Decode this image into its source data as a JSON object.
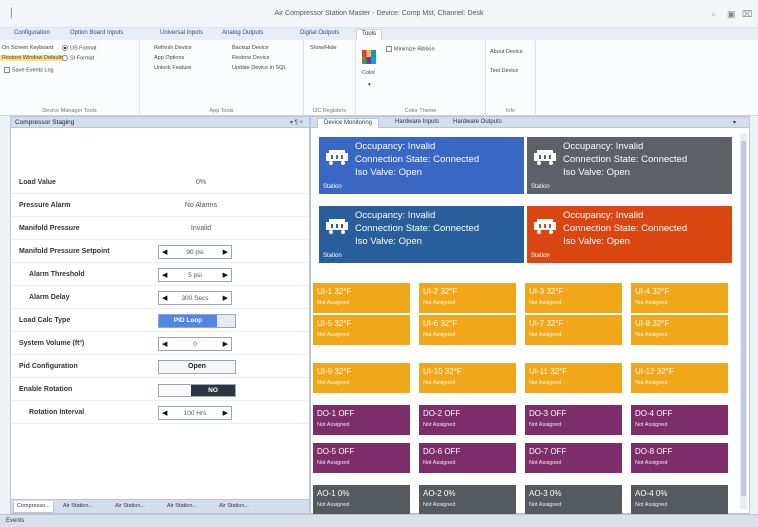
{
  "window": {
    "title": "Air Compressor Station Master - Device: Comp Mst, Channel: Desk"
  },
  "ribbon_tabs": [
    "Configuration",
    "Option Board Inputs",
    "Universal Inputs",
    "Analog Outputs",
    "Digital Outputs",
    "Tools"
  ],
  "ribbon": {
    "device_manager": {
      "title": "Device Manager Tools",
      "on_screen_keyboard": "On Screen Keyboard",
      "restore_window_defaults": "Restore Window Defaults",
      "save_events_log": "Save Events Log",
      "us_format": "US Format",
      "si_format": "SI Format"
    },
    "app_tools": {
      "title": "App Tools",
      "refresh_device": "Refresh Device",
      "app_options": "App Options",
      "unlock_feature": "Unlock Feature",
      "backup_device": "Backup Device",
      "restore_device": "Restore Device",
      "update_device": "Update Device in SQL"
    },
    "i2c": {
      "title": "I2C Registers",
      "show_hide": "Show/Hide"
    },
    "color_theme": {
      "title": "Color Theme",
      "color_label": "Color",
      "minimize_ribbon": "Minimize Ribbon"
    },
    "info": {
      "title": "Info",
      "about_device": "About Device",
      "test_device": "Test Device"
    }
  },
  "left_panel": {
    "title": "Compressor Staging",
    "header_buttons": "▾ ¶ ×",
    "rows": {
      "load_value": {
        "label": "Load Value",
        "value": "0%"
      },
      "pressure_alarm": {
        "label": "Pressure Alarm",
        "value": "No Alarms"
      },
      "manifold_pressure": {
        "label": "Manifold Pressure",
        "value": "Invalid"
      },
      "manifold_setpoint": {
        "label": "Manifold Pressure Setpoint",
        "value": "90 psi"
      },
      "alarm_threshold": {
        "label": "Alarm Threshold",
        "value": "5 psi"
      },
      "alarm_delay": {
        "label": "Alarm Delay",
        "value": "300 Secs"
      },
      "load_calc_type": {
        "label": "Load Calc Type",
        "value": "PID Loop"
      },
      "system_volume": {
        "label": "System Volume (ft³)",
        "value": "0"
      },
      "pid_config": {
        "label": "Pid Configuration",
        "value": "Open"
      },
      "enable_rotation": {
        "label": "Enable Rotation",
        "value": "NO"
      },
      "rotation_interval": {
        "label": "Rotation Interval",
        "value": "100 Hrs"
      }
    },
    "bottom_tabs": [
      "Compresso...",
      "Air Station...",
      "Air Station...",
      "Air Station...",
      "Air Station..."
    ]
  },
  "right_panel": {
    "tabs": [
      "Device Monitoring",
      "Hardware Inputs",
      "Hardware Outputs"
    ],
    "stations": [
      {
        "occupancy": "Occupancy: Invalid",
        "connection": "Connection State: Connected",
        "iso": "Iso Valve: Open",
        "label": "Station",
        "color": "#3a67c4"
      },
      {
        "occupancy": "Occupancy: Invalid",
        "connection": "Connection State: Connected",
        "iso": "Iso Valve: Open",
        "label": "Station",
        "color": "#5d6066"
      },
      {
        "occupancy": "Occupancy: Invalid",
        "connection": "Connection State: Connected",
        "iso": "Iso Valve: Open",
        "label": "Station",
        "color": "#285e9c"
      },
      {
        "occupancy": "Occupancy: Invalid",
        "connection": "Connection State: Connected",
        "iso": "Iso Valve: Open",
        "label": "Station",
        "color": "#d94612"
      }
    ],
    "ui_tiles": [
      {
        "h": "UI-1  32°F",
        "s": "Not Assigned"
      },
      {
        "h": "UI-2  32°F",
        "s": "Not Assigned"
      },
      {
        "h": "UI-3  32°F",
        "s": "Not Assigned"
      },
      {
        "h": "UI-4  32°F",
        "s": "Not Assigned"
      },
      {
        "h": "UI-5  32°F",
        "s": "Not Assigned"
      },
      {
        "h": "UI-6  32°F",
        "s": "Not Assigned"
      },
      {
        "h": "UI-7  32°F",
        "s": "Not Assigned"
      },
      {
        "h": "UI-8  32°F",
        "s": "Not Assigned"
      },
      {
        "h": "UI-9  32°F",
        "s": "Not Assigned"
      },
      {
        "h": "UI-10  32°F",
        "s": "Not Assigned"
      },
      {
        "h": "UI-11  32°F",
        "s": "Not Assigned"
      },
      {
        "h": "UI-12  32°F",
        "s": "Not Assigned"
      }
    ],
    "do_tiles": [
      {
        "h": "DO-1  OFF",
        "s": "Not Assigned"
      },
      {
        "h": "DO-2  OFF",
        "s": "Not Assigned"
      },
      {
        "h": "DO-3  OFF",
        "s": "Not Assigned"
      },
      {
        "h": "DO-4  OFF",
        "s": "Not Assigned"
      },
      {
        "h": "DO-5  OFF",
        "s": "Not Assigned"
      },
      {
        "h": "DO-6  OFF",
        "s": "Not Assigned"
      },
      {
        "h": "DO-7  OFF",
        "s": "Not Assigned"
      },
      {
        "h": "DO-8  OFF",
        "s": "Not Assigned"
      }
    ],
    "ao_tiles": [
      {
        "h": "AO-1  0%",
        "s": "Not Assigned"
      },
      {
        "h": "AO-2  0%",
        "s": "Not Assigned"
      },
      {
        "h": "AO-3  0%",
        "s": "Not Assigned"
      },
      {
        "h": "AO-4  0%",
        "s": "Not Assigned"
      }
    ]
  },
  "status_bar": {
    "text": "Events"
  }
}
